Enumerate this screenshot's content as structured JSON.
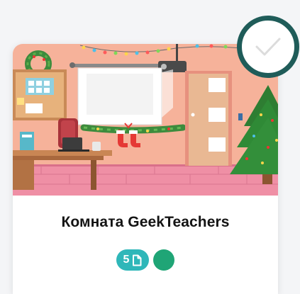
{
  "room": {
    "title": "Комната GeekTeachers",
    "pages_count": "5",
    "page_icon": "document-icon",
    "status_color": "#1fa576",
    "badge_color": "#2fb7b9",
    "selected": true
  }
}
